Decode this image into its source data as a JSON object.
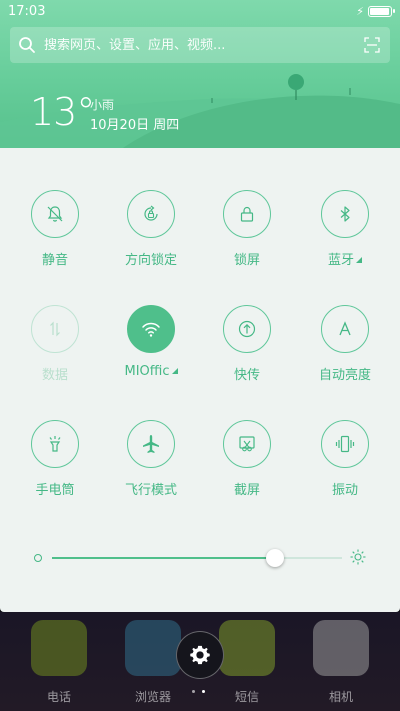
{
  "status_bar": {
    "time": "17:03",
    "battery_level": 1.0
  },
  "search": {
    "placeholder": "搜索网页、设置、应用、视频..."
  },
  "weather": {
    "temperature": "13°",
    "condition": "小雨",
    "date": "10月20日 周四"
  },
  "toggles": [
    {
      "label": "静音",
      "icon": "bell-off-icon",
      "state": "off"
    },
    {
      "label": "方向锁定",
      "icon": "rotation-lock-icon",
      "state": "off"
    },
    {
      "label": "锁屏",
      "icon": "lock-icon",
      "state": "off"
    },
    {
      "label": "蓝牙",
      "icon": "bluetooth-icon",
      "state": "off",
      "has_menu": true
    },
    {
      "label": "数据",
      "icon": "data-arrows-icon",
      "state": "disabled"
    },
    {
      "label": "MIOffic",
      "icon": "wifi-icon",
      "state": "on",
      "has_menu": true
    },
    {
      "label": "快传",
      "icon": "upload-icon",
      "state": "off"
    },
    {
      "label": "自动亮度",
      "icon": "auto-brightness-icon",
      "state": "off"
    },
    {
      "label": "手电筒",
      "icon": "flashlight-icon",
      "state": "off"
    },
    {
      "label": "飞行模式",
      "icon": "airplane-icon",
      "state": "off"
    },
    {
      "label": "截屏",
      "icon": "screenshot-icon",
      "state": "off"
    },
    {
      "label": "振动",
      "icon": "vibrate-icon",
      "state": "off"
    }
  ],
  "brightness": {
    "value": 0.77
  },
  "dock": [
    {
      "label": "电话",
      "icon": "phone-app-icon",
      "color": "#6f8a1f"
    },
    {
      "label": "浏览器",
      "icon": "browser-app-icon",
      "color": "#2f6d88"
    },
    {
      "label": "短信",
      "icon": "messages-app-icon",
      "color": "#7d9a2a"
    },
    {
      "label": "相机",
      "icon": "camera-app-icon",
      "color": "#9a9a9a"
    }
  ],
  "colors": {
    "accent": "#4fbf8b",
    "header_green": "#66cd9a",
    "panel_bg": "#eef3f1"
  }
}
